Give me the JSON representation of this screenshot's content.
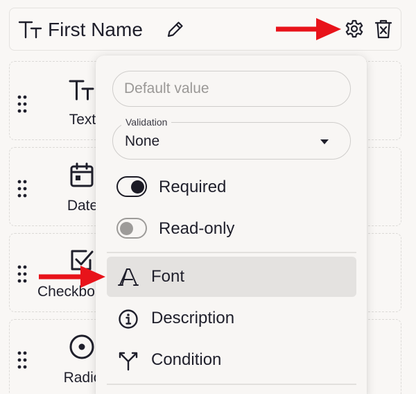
{
  "field": {
    "title": "First Name",
    "type_icon": "text-type-icon",
    "actions": [
      "edit-pencil-icon",
      "gear-icon",
      "trash-icon"
    ]
  },
  "palette": [
    {
      "label": "Text",
      "icon": "text-type-icon"
    },
    {
      "label": "Date",
      "icon": "calendar-icon"
    },
    {
      "label": "Checkbo",
      "icon": "checkbox-icon"
    },
    {
      "label": "Radio",
      "icon": "radio-icon"
    }
  ],
  "menu": {
    "default_value_placeholder": "Default value",
    "validation": {
      "label": "Validation",
      "value": "None"
    },
    "toggles": [
      {
        "label": "Required",
        "on": true
      },
      {
        "label": "Read-only",
        "on": false
      }
    ],
    "items": [
      {
        "label": "Font",
        "icon": "font-icon",
        "highlighted": true
      },
      {
        "label": "Description",
        "icon": "info-icon",
        "highlighted": false
      },
      {
        "label": "Condition",
        "icon": "branch-icon",
        "highlighted": false
      }
    ]
  },
  "colors": {
    "arrow": "#e8131a",
    "ink": "#1f1f2b",
    "background": "#f9f7f5",
    "highlight": "#e4e2e0"
  }
}
